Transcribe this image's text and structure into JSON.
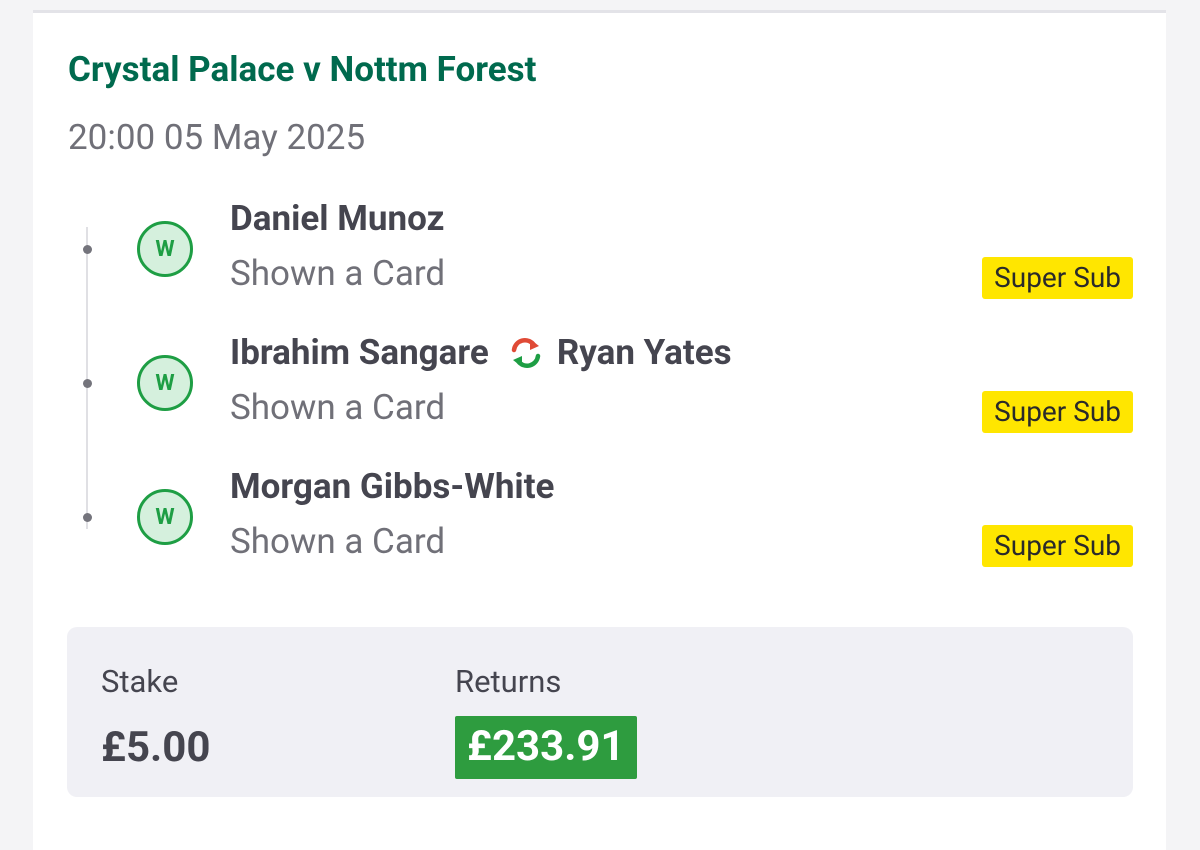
{
  "match": {
    "title": "Crystal Palace v Nottm Forest",
    "datetime": "20:00 05 May 2025"
  },
  "legs": [
    {
      "result": "W",
      "player": "Daniel Munoz",
      "substitute": null,
      "market": "Shown a Card",
      "badge": "Super Sub"
    },
    {
      "result": "W",
      "player": "Ibrahim Sangare",
      "substitute": "Ryan Yates",
      "market": "Shown a Card",
      "badge": "Super Sub"
    },
    {
      "result": "W",
      "player": "Morgan Gibbs-White",
      "substitute": null,
      "market": "Shown a Card",
      "badge": "Super Sub"
    }
  ],
  "summary": {
    "stake_label": "Stake",
    "stake_value": "£5.00",
    "returns_label": "Returns",
    "returns_value": "£233.91"
  },
  "colors": {
    "title_green": "#006a4e",
    "win_green": "#1e9e44",
    "super_sub_yellow": "#ffe600",
    "returns_green": "#2e9c3f"
  },
  "icons": {
    "result": "win-circle-icon",
    "substitution": "substitution-arrows-icon"
  }
}
